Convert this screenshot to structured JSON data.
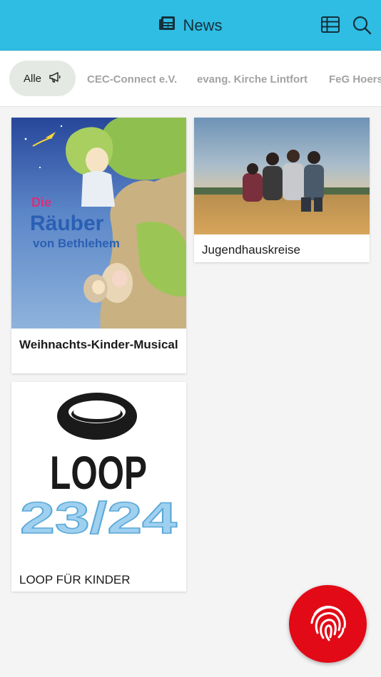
{
  "header": {
    "title": "News",
    "icons": {
      "title": "newspaper-icon",
      "grid": "table-grid-icon",
      "search": "search-icon"
    }
  },
  "tabs": [
    {
      "label": "Alle",
      "active": true,
      "icon": "megaphone-icon"
    },
    {
      "label": "CEC-Connect e.V.",
      "active": false
    },
    {
      "label": "evang. Kirche Lintfort",
      "active": false
    },
    {
      "label": "FeG Hoerst",
      "active": false
    }
  ],
  "cards": [
    {
      "caption": " Weihnachts-Kinder-Musical",
      "image_text": [
        "Die",
        "Räuber",
        "von Bethlehem"
      ]
    },
    {
      "caption": "Jugendhauskreise"
    },
    {
      "caption": "LOOP FÜR KINDER",
      "image_text": [
        "LOOP",
        "23/24"
      ]
    }
  ],
  "fab": {
    "icon": "fingerprint-icon"
  },
  "colors": {
    "header": "#2fbde3",
    "fab": "#e20a16",
    "active_tab": "#e4e9e4"
  }
}
